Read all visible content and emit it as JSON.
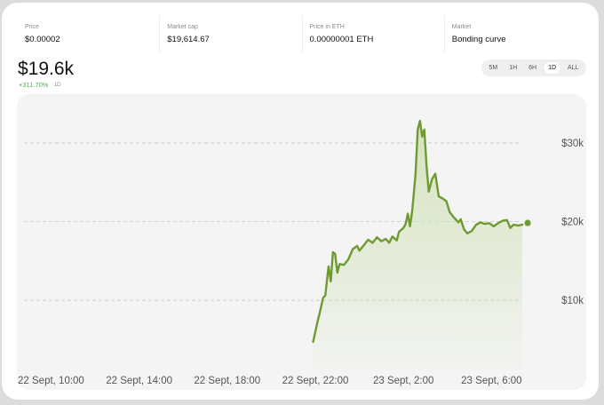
{
  "stats": [
    {
      "label": "Price",
      "value": "$0.00002"
    },
    {
      "label": "Market cap",
      "value": "$19,614.67"
    },
    {
      "label": "Price in ETH",
      "value": "0.00000001 ETH"
    },
    {
      "label": "Market",
      "value": "Bonding curve"
    }
  ],
  "headline": {
    "value": "$19.6k",
    "change": "+311.70%",
    "period": "1D"
  },
  "ranges": [
    {
      "label": "5M",
      "active": false
    },
    {
      "label": "1H",
      "active": false
    },
    {
      "label": "6H",
      "active": false
    },
    {
      "label": "1D",
      "active": true
    },
    {
      "label": "ALL",
      "active": false
    }
  ],
  "colors": {
    "line": "#6f9a32",
    "fill_top": "#cfe0b4",
    "grid": "#c8c8c8"
  },
  "chart_data": {
    "type": "area",
    "x_unit": "hours from 22 Sept 10:00",
    "x_ticks": [
      {
        "label": "22 Sept, 10:00",
        "x": 0
      },
      {
        "label": "22 Sept, 14:00",
        "x": 4
      },
      {
        "label": "22 Sept, 18:00",
        "x": 8
      },
      {
        "label": "22 Sept, 22:00",
        "x": 12
      },
      {
        "label": "23 Sept, 2:00",
        "x": 16
      },
      {
        "label": "23 Sept, 6:00",
        "x": 20
      }
    ],
    "y_ticks": [
      {
        "label": "$10k",
        "value": 10000
      },
      {
        "label": "$20k",
        "value": 20000
      },
      {
        "label": "$30k",
        "value": 30000
      }
    ],
    "xlim": [
      -1.55,
      24.3
    ],
    "ylim": [
      1200,
      36200
    ],
    "grid": true,
    "series": [
      {
        "points": [
          [
            11.9,
            4700
          ],
          [
            12.1,
            7300
          ],
          [
            12.2,
            8400
          ],
          [
            12.35,
            10300
          ],
          [
            12.45,
            10600
          ],
          [
            12.6,
            14300
          ],
          [
            12.7,
            12400
          ],
          [
            12.8,
            16100
          ],
          [
            12.9,
            15900
          ],
          [
            13.0,
            13500
          ],
          [
            13.1,
            14600
          ],
          [
            13.3,
            14500
          ],
          [
            13.5,
            15200
          ],
          [
            13.7,
            16500
          ],
          [
            13.9,
            16900
          ],
          [
            14.0,
            16300
          ],
          [
            14.2,
            17000
          ],
          [
            14.4,
            17700
          ],
          [
            14.6,
            17300
          ],
          [
            14.8,
            18000
          ],
          [
            15.0,
            17500
          ],
          [
            15.2,
            17800
          ],
          [
            15.35,
            17300
          ],
          [
            15.5,
            18100
          ],
          [
            15.7,
            17600
          ],
          [
            15.8,
            18700
          ],
          [
            16.0,
            19200
          ],
          [
            16.1,
            19700
          ],
          [
            16.2,
            21000
          ],
          [
            16.3,
            19400
          ],
          [
            16.4,
            21400
          ],
          [
            16.55,
            26000
          ],
          [
            16.65,
            31700
          ],
          [
            16.75,
            32800
          ],
          [
            16.85,
            30800
          ],
          [
            16.95,
            31700
          ],
          [
            17.05,
            27100
          ],
          [
            17.15,
            23800
          ],
          [
            17.3,
            25400
          ],
          [
            17.45,
            26100
          ],
          [
            17.6,
            23200
          ],
          [
            17.8,
            22900
          ],
          [
            17.95,
            22600
          ],
          [
            18.1,
            21200
          ],
          [
            18.3,
            20500
          ],
          [
            18.5,
            19900
          ],
          [
            18.6,
            20300
          ],
          [
            18.75,
            19000
          ],
          [
            18.9,
            18500
          ],
          [
            19.1,
            18800
          ],
          [
            19.3,
            19600
          ],
          [
            19.5,
            19900
          ],
          [
            19.7,
            19700
          ],
          [
            19.9,
            19800
          ],
          [
            20.1,
            19400
          ],
          [
            20.3,
            19800
          ],
          [
            20.5,
            20100
          ],
          [
            20.7,
            20200
          ],
          [
            20.85,
            19200
          ],
          [
            21.0,
            19600
          ],
          [
            21.2,
            19500
          ],
          [
            21.4,
            19600
          ]
        ]
      }
    ]
  }
}
